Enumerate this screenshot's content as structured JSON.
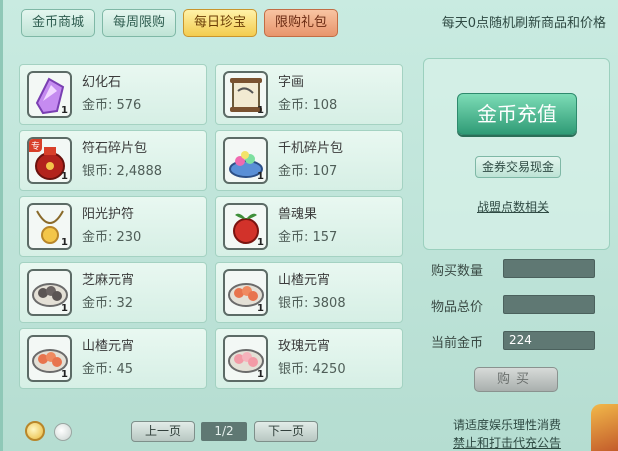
{
  "tabs": [
    {
      "label": "金币商城"
    },
    {
      "label": "每周限购"
    },
    {
      "label": "每日珍宝"
    },
    {
      "label": "限购礼包"
    }
  ],
  "notice": "每天0点随机刷新商品和价格",
  "items": [
    {
      "name": "幻化石",
      "price": "金币: 576",
      "qty": "1",
      "icon": "crystal-icon"
    },
    {
      "name": "字画",
      "price": "金币: 108",
      "qty": "1",
      "icon": "scroll-icon"
    },
    {
      "name": "符石碎片包",
      "price": "银币: 2,4888",
      "qty": "1",
      "tag": "专",
      "icon": "pouch-icon"
    },
    {
      "name": "千机碎片包",
      "price": "金币: 107",
      "qty": "1",
      "icon": "gem-bowl-icon"
    },
    {
      "name": "阳光护符",
      "price": "金币: 230",
      "qty": "1",
      "icon": "amulet-icon"
    },
    {
      "name": "兽魂果",
      "price": "金币: 157",
      "qty": "1",
      "icon": "fruit-icon"
    },
    {
      "name": "芝麻元宵",
      "price": "金币: 32",
      "qty": "1",
      "icon": "sesame-dumpling-icon"
    },
    {
      "name": "山楂元宵",
      "price": "银币: 3808",
      "qty": "1",
      "icon": "hawthorn-dumpling-icon"
    },
    {
      "name": "山楂元宵",
      "price": "金币: 45",
      "qty": "1",
      "icon": "hawthorn-dumpling-icon"
    },
    {
      "name": "玫瑰元宵",
      "price": "银币: 4250",
      "qty": "1",
      "icon": "rose-dumpling-icon"
    }
  ],
  "right": {
    "recharge": "金币充值",
    "exchange": "金券交易现金",
    "alliance": "战盟点数相关"
  },
  "form": {
    "qty_label": "购买数量",
    "qty_value": "",
    "total_label": "物品总价",
    "total_value": "",
    "gold_label": "当前金币",
    "gold_value": "224",
    "buy": "购买"
  },
  "pager": {
    "prev": "上一页",
    "page": "1/2",
    "next": "下一页"
  },
  "footer": {
    "line1": "请适度娱乐理性消费",
    "line2": "禁止和打击代充公告"
  }
}
